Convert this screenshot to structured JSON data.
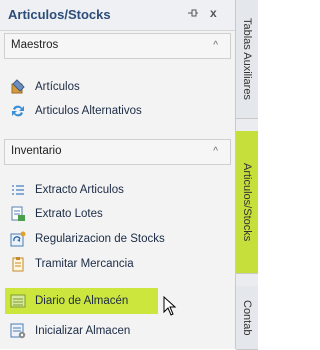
{
  "panel": {
    "title": "Articulos/Stocks",
    "pin_icon": "pin-icon",
    "close_glyph": "x"
  },
  "groups": [
    {
      "title": "Maestros",
      "collapse_glyph": "^",
      "items": [
        {
          "label": "Artículos",
          "icon": "box-tag-icon"
        },
        {
          "label": "Articulos Alternativos",
          "icon": "swap-arrows-icon"
        }
      ]
    },
    {
      "title": "Inventario",
      "collapse_glyph": "^",
      "items": [
        {
          "label": "Extracto Articulos",
          "icon": "list-icon"
        },
        {
          "label": "Extrato Lotes",
          "icon": "lots-icon"
        },
        {
          "label": "Regularizacion de Stocks",
          "icon": "regularize-icon"
        },
        {
          "label": "Tramitar Mercancia",
          "icon": "clipboard-icon"
        },
        {
          "label": "Diario de Almacén",
          "icon": "journal-icon",
          "selected": true
        },
        {
          "label": "Inicializar Almacen",
          "icon": "init-warehouse-icon"
        }
      ]
    }
  ],
  "side_tabs": [
    {
      "label": "Tablas Auxiliares",
      "icon": "folder-icon"
    },
    {
      "label": "Articulos/Stocks",
      "icon": "folder-icon",
      "active": true
    },
    {
      "label": "Contab",
      "icon": "dots-icon"
    }
  ],
  "colors": {
    "highlight": "#cde63e",
    "title_text": "#2c4d7a"
  }
}
